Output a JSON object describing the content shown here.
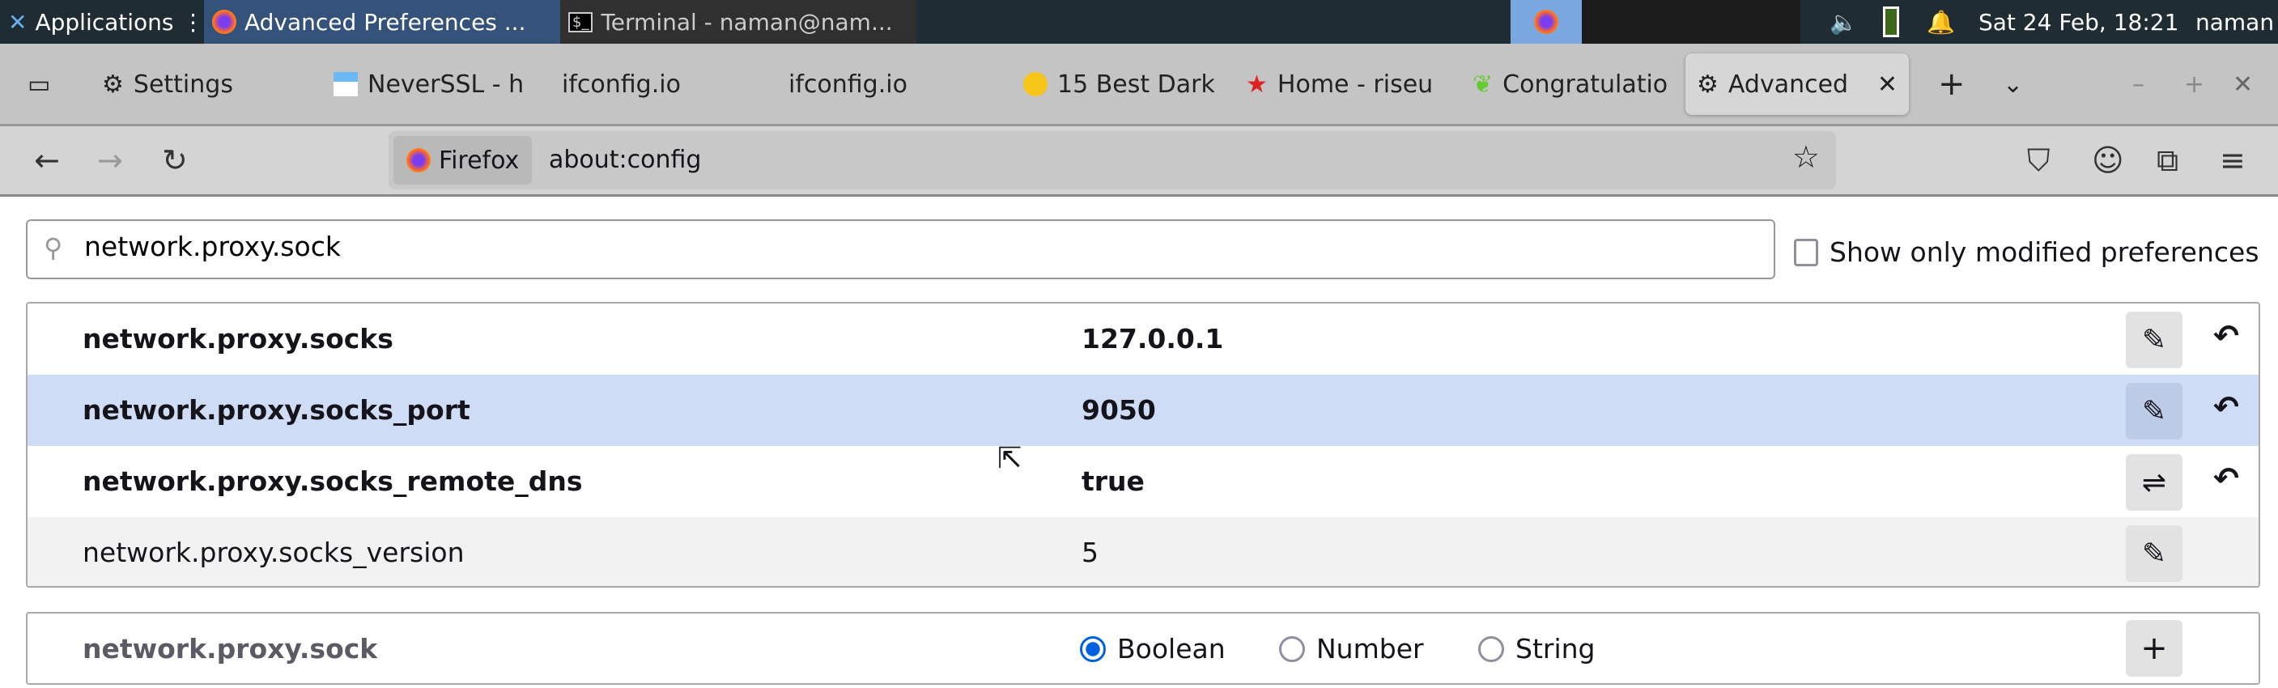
{
  "taskbar": {
    "applications": "Applications",
    "windows": [
      {
        "title": "Advanced Preferences ...",
        "active": true
      },
      {
        "title": "Terminal - naman@nam...",
        "active": false
      }
    ],
    "clock": "Sat 24 Feb, 18:21",
    "user": "naman"
  },
  "tabs": [
    {
      "label": "Settings",
      "icon": "gear-icon"
    },
    {
      "label": "NeverSSL - h",
      "icon": "neverssl-icon"
    },
    {
      "label": "ifconfig.io",
      "icon": ""
    },
    {
      "label": "ifconfig.io",
      "icon": ""
    },
    {
      "label": "15 Best Dark",
      "icon": "cyberghost-icon"
    },
    {
      "label": "Home - riseu",
      "icon": "riseup-icon"
    },
    {
      "label": "Congratulatio",
      "icon": "leaf-icon"
    },
    {
      "label": "Advanced",
      "icon": "gear-icon",
      "active": true
    }
  ],
  "nav": {
    "identity": "Firefox",
    "url": "about:config"
  },
  "search": {
    "value": "network.proxy.sock"
  },
  "filter": {
    "label": "Show only modified preferences",
    "checked": false
  },
  "prefs": [
    {
      "name": "network.proxy.socks",
      "value": "127.0.0.1",
      "modified": true,
      "action": "edit",
      "highlighted": false
    },
    {
      "name": "network.proxy.socks_port",
      "value": "9050",
      "modified": true,
      "action": "edit",
      "highlighted": true
    },
    {
      "name": "network.proxy.socks_remote_dns",
      "value": "true",
      "modified": true,
      "action": "toggle",
      "highlighted": false
    },
    {
      "name": "network.proxy.socks_version",
      "value": "5",
      "modified": false,
      "action": "edit",
      "highlighted": false
    }
  ],
  "add": {
    "name": "network.proxy.sock",
    "types": [
      "Boolean",
      "Number",
      "String"
    ],
    "selected": "Boolean"
  },
  "colors": {
    "highlight": "#cfdcf5",
    "accent": "#0061e0",
    "taskbar": "#202c33"
  }
}
